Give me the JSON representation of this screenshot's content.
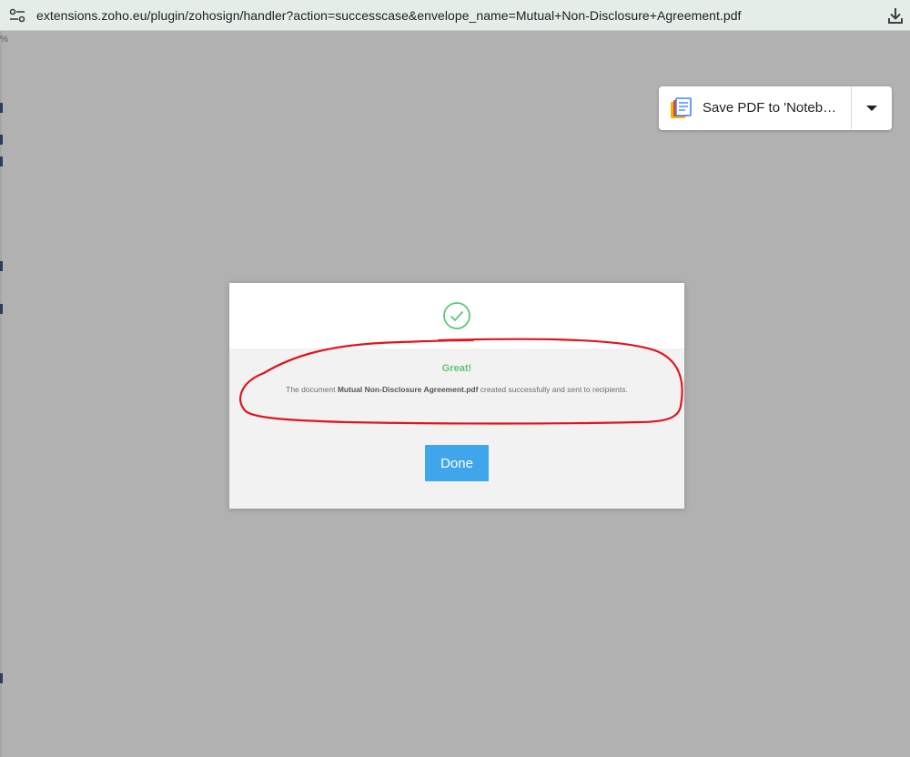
{
  "browser": {
    "url": "extensions.zoho.eu/plugin/zohosign/handler?action=successcase&envelope_name=Mutual+Non-Disclosure+Agreement.pdf",
    "left_edge_text": "%"
  },
  "save_pdf_widget": {
    "label": "Save PDF to 'Noteb…"
  },
  "dialog": {
    "heading": "Great!",
    "message_prefix": "The document ",
    "document_name": "Mutual Non-Disclosure Agreement.pdf",
    "message_suffix": " created successfully and sent to recipients.",
    "done_label": "Done"
  },
  "colors": {
    "overlay": "#b1b1b1",
    "success_green": "#5cc777",
    "button_blue": "#3fa6eb",
    "annotation_red": "#e0141e"
  }
}
